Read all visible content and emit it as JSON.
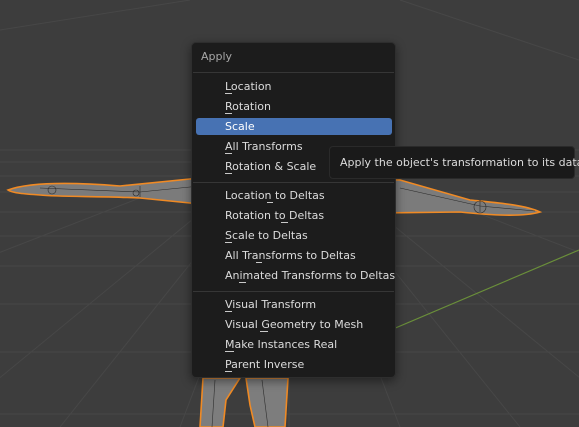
{
  "menu": {
    "title": "Apply",
    "groups": [
      [
        "Location",
        "Rotation",
        "Scale",
        "All Transforms",
        "Rotation & Scale"
      ],
      [
        "Location to Deltas",
        "Rotation to Deltas",
        "Scale to Deltas",
        "All Transforms to Deltas",
        "Animated Transforms to Deltas"
      ],
      [
        "Visual Transform",
        "Visual Geometry to Mesh",
        "Make Instances Real",
        "Parent Inverse"
      ]
    ],
    "active_item": "Scale"
  },
  "tooltip": {
    "text": "Apply the object's transformation to its data."
  },
  "colors": {
    "viewport_bg": "#3d3d3d",
    "grid_line": "#474747",
    "axis_green": "#6a8f3a",
    "menu_bg": "#1c1c1c",
    "highlight": "#4772b3",
    "selection_outline": "#f08a24",
    "mesh": "#7d7d7d"
  }
}
